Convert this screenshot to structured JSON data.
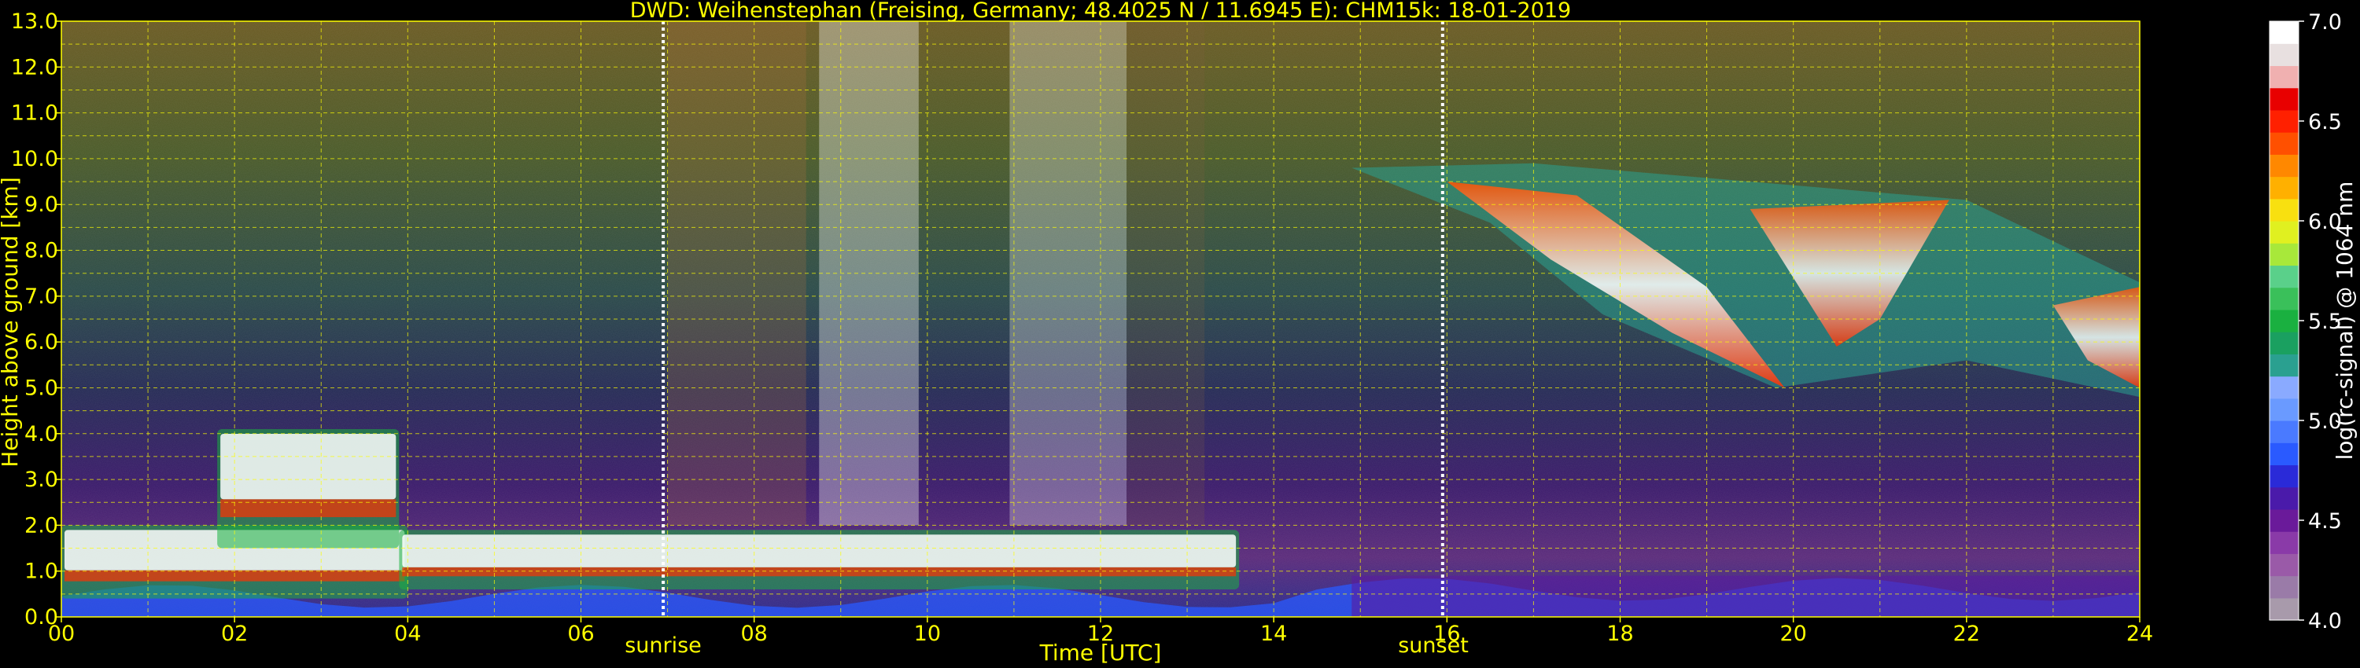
{
  "chart_data": {
    "type": "heatmap",
    "title": "DWD: Weihenstephan (Freising, Germany; 48.4025 N / 11.6945 E):    CHM15k: 18-01-2019",
    "xlabel": "Time [UTC]",
    "ylabel": "Height above ground [km]",
    "x_ticks": [
      "00",
      "02",
      "04",
      "06",
      "08",
      "10",
      "12",
      "14",
      "16",
      "18",
      "20",
      "22",
      "24"
    ],
    "y_ticks": [
      "0.0",
      "1.0",
      "2.0",
      "3.0",
      "4.0",
      "5.0",
      "6.0",
      "7.0",
      "8.0",
      "9.0",
      "10.0",
      "11.0",
      "12.0",
      "13.0"
    ],
    "xlim": [
      0,
      24
    ],
    "ylim": [
      0,
      13
    ],
    "grid": true,
    "annotations": [
      {
        "text": "sunrise",
        "x": 6.95
      },
      {
        "text": "sunset",
        "x": 15.95
      }
    ],
    "colorbar": {
      "label": "log(rc-signal) @ 1064 nm",
      "range": [
        4.0,
        7.0
      ],
      "ticks": [
        "4.0",
        "4.5",
        "5.0",
        "5.5",
        "6.0",
        "6.5",
        "7.0"
      ],
      "colors": [
        "#a89aab",
        "#9a7ba8",
        "#9a5aa8",
        "#8a3aa8",
        "#6a1a9a",
        "#4a1aaa",
        "#2a2ad8",
        "#2a5aff",
        "#4a7aff",
        "#6a9aff",
        "#8aaaff",
        "#2aa090",
        "#1aa060",
        "#1ab040",
        "#3ac05a",
        "#5ad08a",
        "#a8e83a",
        "#e0f020",
        "#f8e010",
        "#ffb000",
        "#ff8800",
        "#ff5000",
        "#ff2000",
        "#e80000",
        "#f0b0b0",
        "#e8e0e0",
        "#ffffff"
      ]
    },
    "clouds": [
      {
        "kind": "low boundary-layer cloud",
        "t_start": 0.0,
        "t_end": 4.0,
        "base_km": 0.4,
        "top_km": 2.0
      },
      {
        "kind": "elevated cloud",
        "t_start": 1.8,
        "t_end": 3.9,
        "base_km": 1.5,
        "top_km": 4.1
      },
      {
        "kind": "stratocumulus",
        "t_start": 3.9,
        "t_end": 13.6,
        "base_km": 0.6,
        "top_km": 1.9
      },
      {
        "kind": "cirrus",
        "t_start": 14.9,
        "t_end": 24.0,
        "base_km": 4.8,
        "top_km": 9.9
      }
    ]
  }
}
